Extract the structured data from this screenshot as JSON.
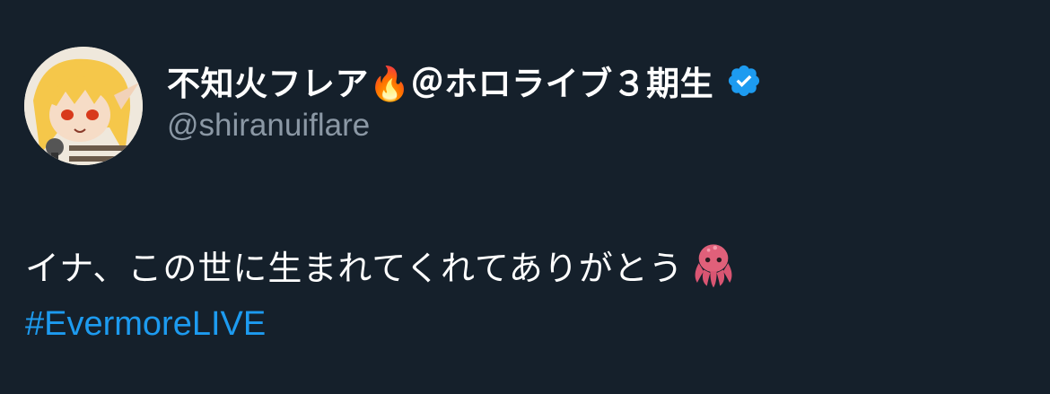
{
  "tweet": {
    "author": {
      "display_name": "不知火フレア🔥＠ホロライブ３期生",
      "handle": "@shiranuiflare",
      "verified_icon": "verified-badge-icon",
      "avatar_icon": "avatar"
    },
    "text": "イナ、この世に生まれてくれてありがとう",
    "emoji": "octopus-icon",
    "hashtag": "#EvermoreLIVE"
  },
  "colors": {
    "background": "#15202b",
    "primary_text": "#ffffff",
    "secondary_text": "#8b98a5",
    "link": "#1d9bf0",
    "verified": "#1d9bf0"
  }
}
